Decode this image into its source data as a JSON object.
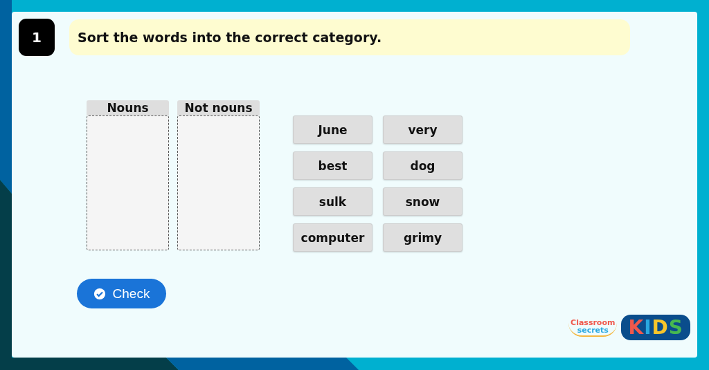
{
  "question": {
    "number": "1",
    "prompt": "Sort the words into the correct category."
  },
  "categories": [
    {
      "label": "Nouns"
    },
    {
      "label": "Not nouns"
    }
  ],
  "words": [
    {
      "text": "June"
    },
    {
      "text": "very"
    },
    {
      "text": "best"
    },
    {
      "text": "dog"
    },
    {
      "text": "sulk"
    },
    {
      "text": "snow"
    },
    {
      "text": "computer"
    },
    {
      "text": "grimy"
    }
  ],
  "check_button": {
    "label": "Check"
  },
  "logo": {
    "line_1": "Classroom",
    "line_2": "secrets",
    "kids_letters": [
      {
        "text": "K",
        "color": "#f0584c"
      },
      {
        "text": "I",
        "color": "#29a8e0"
      },
      {
        "text": "D",
        "color": "#f7c52b"
      },
      {
        "text": "S",
        "color": "#47b950"
      }
    ]
  }
}
